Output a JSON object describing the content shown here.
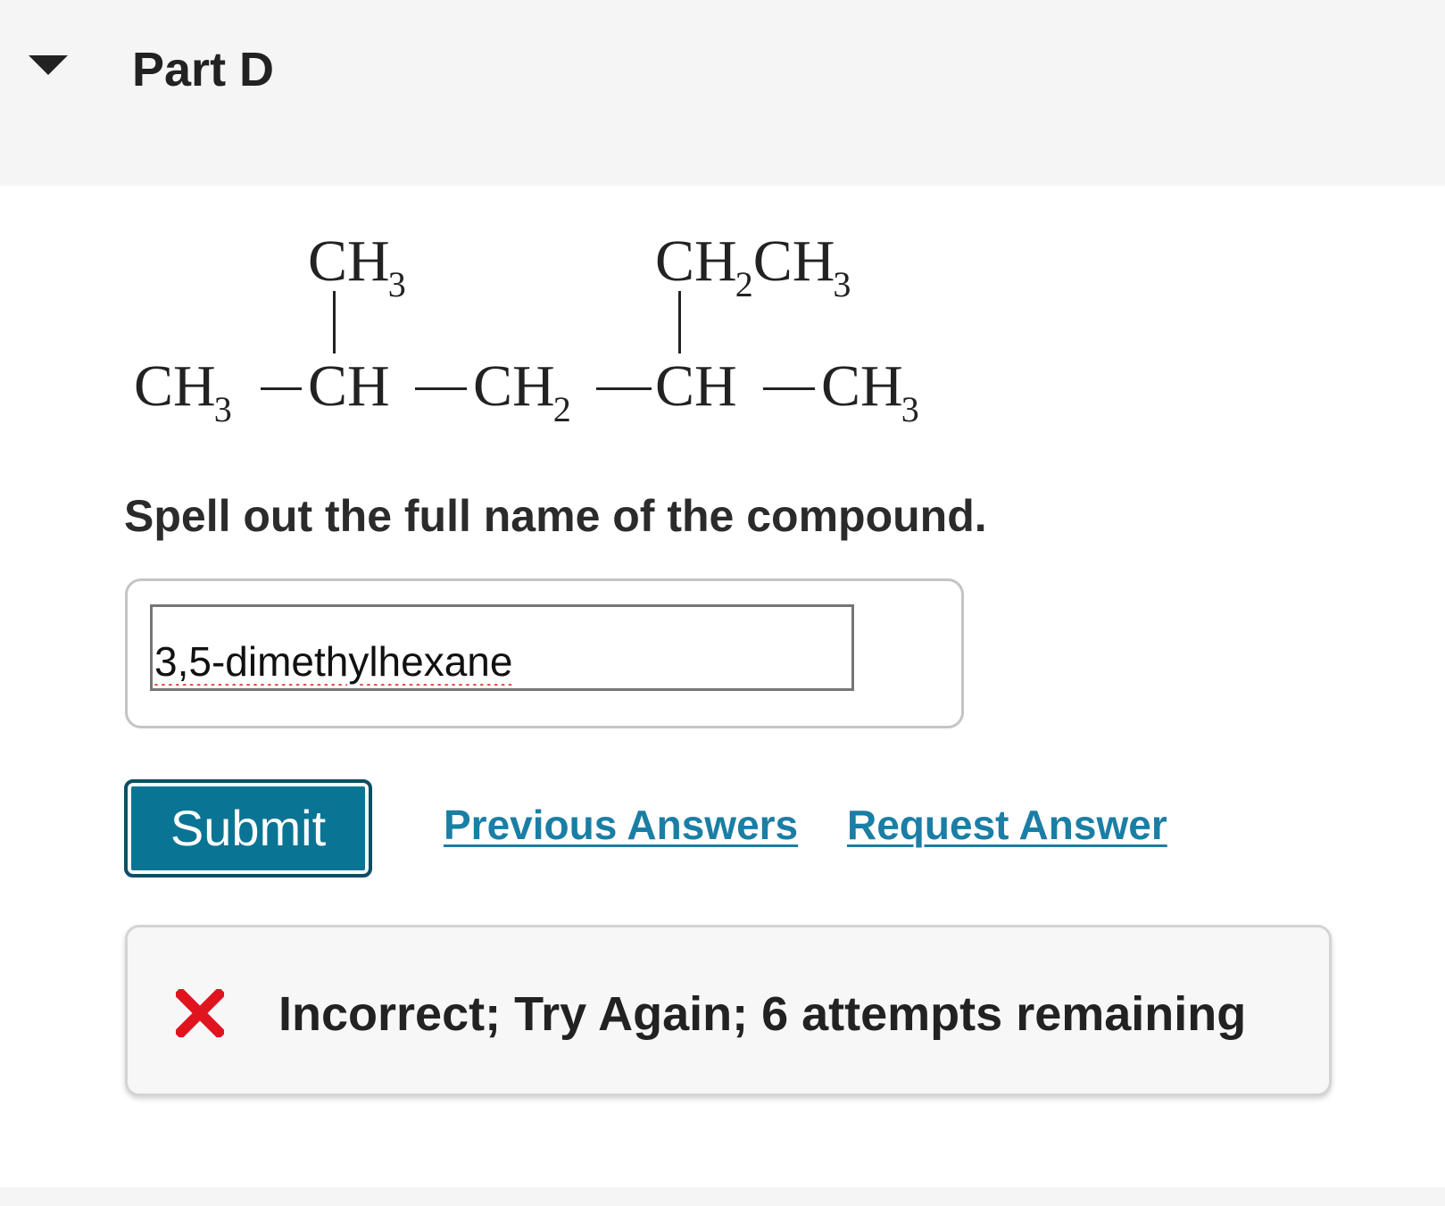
{
  "header": {
    "part_title": "Part D"
  },
  "structure": {
    "top_left_group": {
      "main": "CH",
      "sub": "3"
    },
    "top_right_group": {
      "main1": "CH",
      "sub1": "2",
      "main2": "CH",
      "sub2": "3"
    },
    "chain": [
      {
        "main": "CH",
        "sub": "3"
      },
      {
        "main": "CH",
        "sub": ""
      },
      {
        "main": "CH",
        "sub": "2"
      },
      {
        "main": "CH",
        "sub": ""
      },
      {
        "main": "CH",
        "sub": "3"
      }
    ]
  },
  "question": {
    "prompt": "Spell out the full name of the compound."
  },
  "answer": {
    "value": "3,5-dimethylhexane"
  },
  "actions": {
    "submit_label": "Submit",
    "previous_answers_label": "Previous Answers",
    "request_answer_label": "Request Answer"
  },
  "feedback": {
    "message": "Incorrect; Try Again; 6 attempts remaining",
    "icon": "x-icon",
    "icon_color": "#e0141e"
  },
  "colors": {
    "header_bg": "#f5f5f5",
    "submit_bg": "#0a7494",
    "link": "#1a7ea5"
  }
}
